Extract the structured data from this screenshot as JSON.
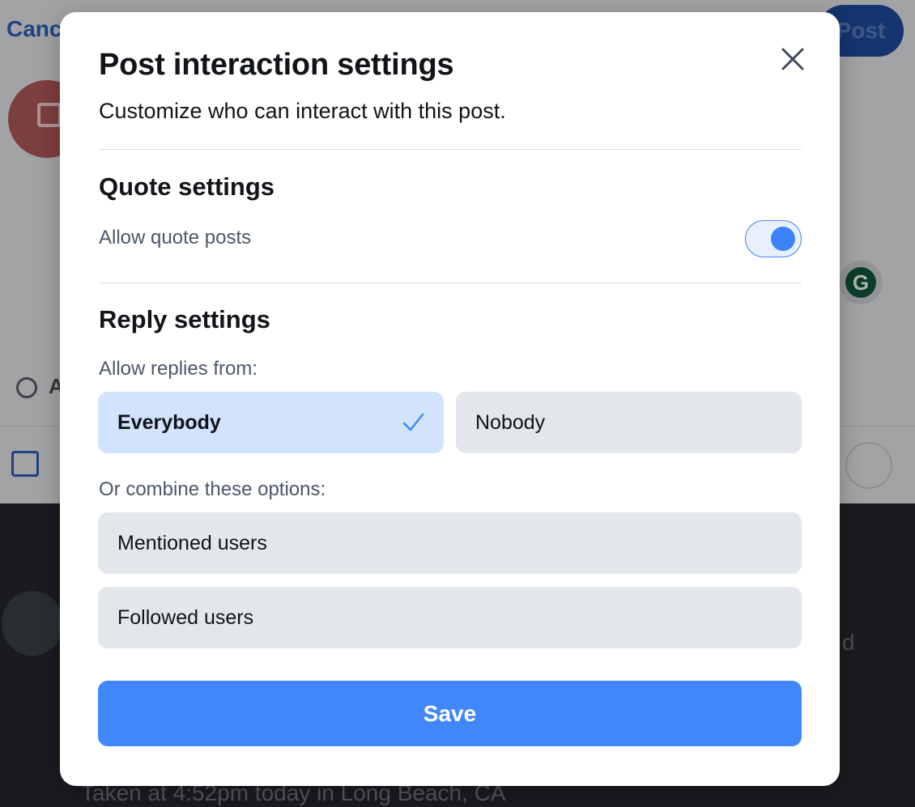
{
  "background": {
    "cancel_label": "Canc",
    "post_label": "Post",
    "visibility_label_partial": "A",
    "grammarly_letter": "G",
    "feed_caption": "Taken at 4:52pm today in Long Beach, CA",
    "feed_side_text": "d"
  },
  "modal": {
    "title": "Post interaction settings",
    "subtitle": "Customize who can interact with this post.",
    "quote": {
      "heading": "Quote settings",
      "allow_label": "Allow quote posts",
      "allow_enabled": true
    },
    "reply": {
      "heading": "Reply settings",
      "allow_from_label": "Allow replies from:",
      "options": [
        {
          "label": "Everybody",
          "selected": true
        },
        {
          "label": "Nobody",
          "selected": false
        }
      ],
      "combine_label": "Or combine these options:",
      "combine_options": [
        {
          "label": "Mentioned users",
          "selected": false
        },
        {
          "label": "Followed users",
          "selected": false
        }
      ]
    },
    "save_label": "Save"
  },
  "colors": {
    "accent": "#3f87fb",
    "selected_option_bg": "#d1e3fd",
    "option_bg": "#e3e6eb"
  }
}
